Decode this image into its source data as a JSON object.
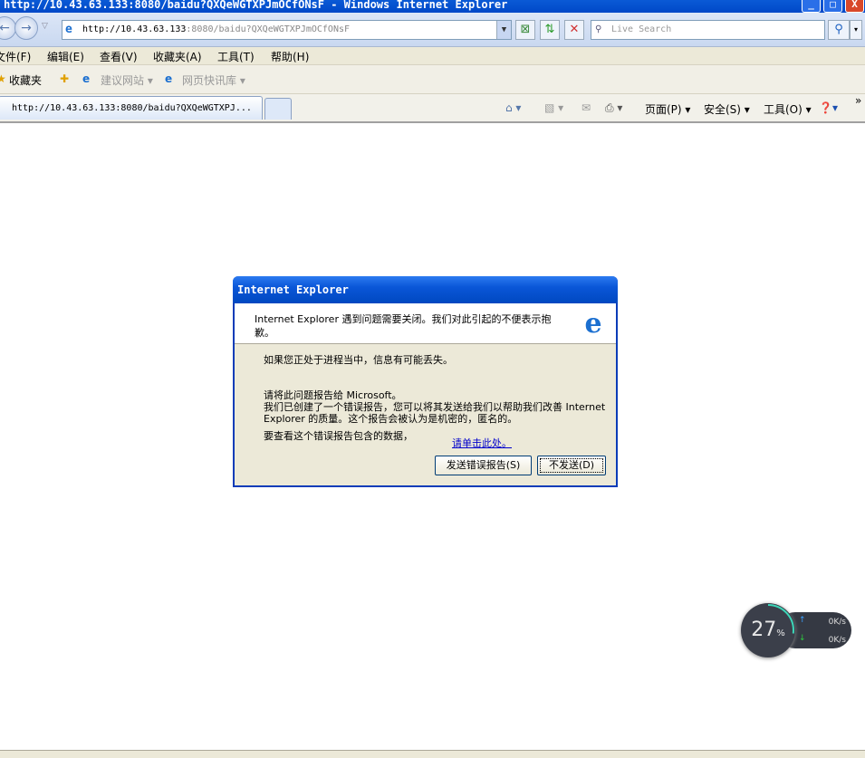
{
  "window": {
    "title": "http://10.43.63.133:8080/baidu?QXQeWGTXPJmOCfONsF - Windows Internet Explorer"
  },
  "address": {
    "host": "http://10.43.63.133",
    "rest": ":8080/baidu?QXQeWGTXPJmOCfONsF"
  },
  "search": {
    "placeholder": "Live Search"
  },
  "menu": [
    "文件(F)",
    "编辑(E)",
    "查看(V)",
    "收藏夹(A)",
    "工具(T)",
    "帮助(H)"
  ],
  "favorites": {
    "label": "收藏夹",
    "items": [
      "建议网站 ▾",
      "网页快讯库 ▾"
    ]
  },
  "tab": {
    "label": "http://10.43.63.133:8080/baidu?QXQeWGTXPJ..."
  },
  "commandbar": {
    "page": "页面(P) ▾",
    "safety": "安全(S) ▾",
    "tools": "工具(O) ▾",
    "more": "»"
  },
  "dialog": {
    "title": "Internet Explorer",
    "header": "Internet Explorer 遇到问题需要关闭。我们对此引起的不便表示抱歉。",
    "line1": "如果您正处于进程当中，信息有可能丢失。",
    "line2": "请将此问题报告给 Microsoft。",
    "line3": "我们已创建了一个错误报告，您可以将其发送给我们以帮助我们改善 Internet Explorer 的质量。这个报告会被认为是机密的，匿名的。",
    "line4": "要查看这个错误报告包含的数据，",
    "link": "请单击此处。",
    "send": "发送错误报告(S)",
    "dont_send": "不发送(D)"
  },
  "widget": {
    "percent": "27",
    "unit": "%",
    "up": "0K/s",
    "down": "0K/s",
    "up_color": "#3aa0ff",
    "down_color": "#2ecc40"
  }
}
